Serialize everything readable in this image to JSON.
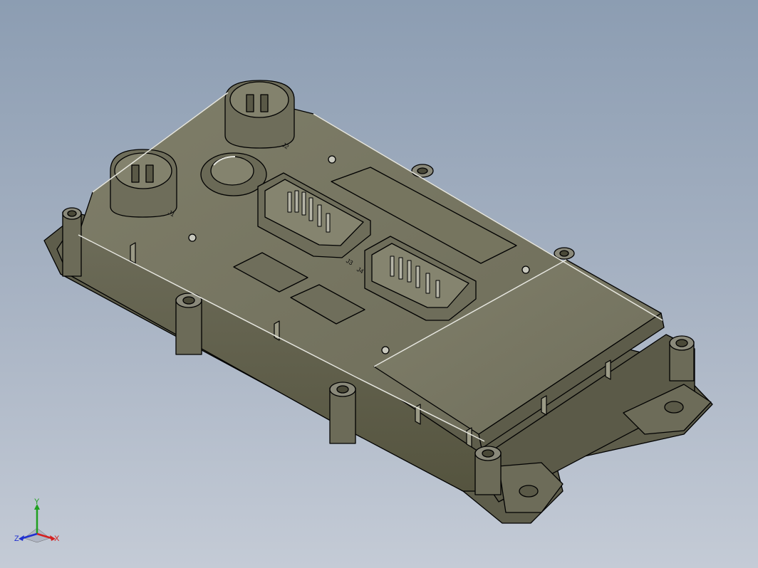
{
  "viewport": {
    "background_top": "#8c9db2",
    "background_bottom": "#c4cbd6"
  },
  "model": {
    "body_color": "#74735f",
    "body_light": "#8d8c76",
    "body_dark": "#4f4e3f",
    "edge_color": "#000000",
    "highlight_color": "#e8e8e0",
    "connector_labels": [
      "J1",
      "J2",
      "J3",
      "J4"
    ]
  },
  "triad": {
    "x_label": "X",
    "y_label": "Y",
    "z_label": "Z",
    "x_color": "#d42020",
    "y_color": "#20a020",
    "z_color": "#2030d0"
  }
}
